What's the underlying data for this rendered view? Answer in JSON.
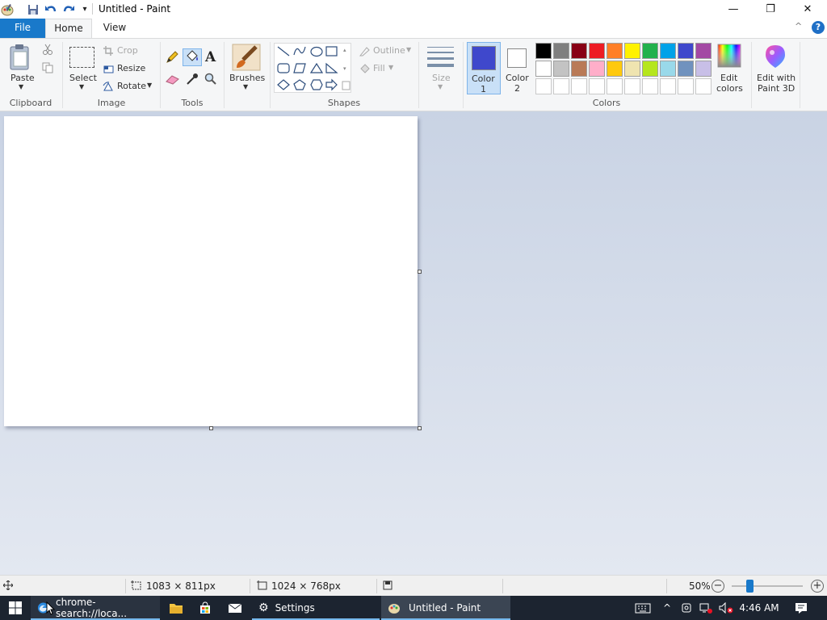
{
  "window": {
    "title": "Untitled - Paint",
    "minimize_glyph": "—",
    "restore_glyph": "❐",
    "close_glyph": "✕",
    "qat_dropdown_glyph": "▾"
  },
  "tabs": {
    "file": "File",
    "home": "Home",
    "view": "View"
  },
  "clipboard": {
    "paste": "Paste",
    "group": "Clipboard"
  },
  "image": {
    "select": "Select",
    "crop": "Crop",
    "resize": "Resize",
    "rotate": "Rotate",
    "group": "Image"
  },
  "tools": {
    "group": "Tools",
    "text_glyph": "A"
  },
  "brushes": {
    "label": "Brushes"
  },
  "shapes": {
    "outline": "Outline",
    "fill": "Fill",
    "group": "Shapes"
  },
  "size": {
    "label": "Size"
  },
  "colors": {
    "color1_label": "Color\n1",
    "color1_line1": "Color",
    "color1_line2": "1",
    "color2_line1": "Color",
    "color2_line2": "2",
    "color1": "#3f48cc",
    "color2": "#ffffff",
    "edit_colors_line1": "Edit",
    "edit_colors_line2": "colors",
    "group": "Colors",
    "palette_row1": [
      "#000000",
      "#7f7f7f",
      "#880015",
      "#ed1c24",
      "#ff7f27",
      "#fff200",
      "#22b14c",
      "#00a2e8",
      "#3f48cc",
      "#a349a4"
    ],
    "palette_row2": [
      "#ffffff",
      "#c3c3c3",
      "#b97a57",
      "#ffaec9",
      "#ffc90e",
      "#efe4b0",
      "#b5e61d",
      "#99d9ea",
      "#7092be",
      "#c8bfe7"
    ]
  },
  "paint3d": {
    "line1": "Edit with",
    "line2": "Paint 3D"
  },
  "help_glyph": "?",
  "collapse_glyph": "^",
  "status": {
    "selection_size": "1083 × 811px",
    "image_size": "1024 × 768px",
    "zoom": "50%",
    "zoom_fraction": 0.5
  },
  "taskbar": {
    "chrome_item": "chrome-search://loca...",
    "settings": "Settings",
    "paint": "Untitled - Paint",
    "time": "4:46 AM"
  }
}
